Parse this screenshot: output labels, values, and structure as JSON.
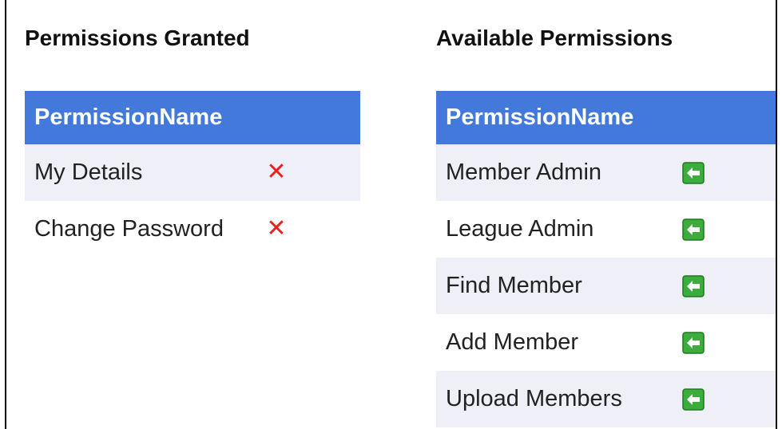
{
  "granted": {
    "title": "Permissions Granted",
    "column_header": "PermissionName",
    "rows": [
      {
        "name": "My Details",
        "action_icon": "remove-icon"
      },
      {
        "name": "Change Password",
        "action_icon": "remove-icon"
      }
    ]
  },
  "available": {
    "title": "Available Permissions",
    "column_header": "PermissionName",
    "rows": [
      {
        "name": "Member Admin",
        "action_icon": "add-arrow-icon"
      },
      {
        "name": "League Admin",
        "action_icon": "add-arrow-icon"
      },
      {
        "name": "Find Member",
        "action_icon": "add-arrow-icon"
      },
      {
        "name": "Add Member",
        "action_icon": "add-arrow-icon"
      },
      {
        "name": "Upload Members",
        "action_icon": "add-arrow-icon"
      }
    ]
  },
  "icons": {
    "remove_glyph": "✕"
  },
  "colors": {
    "header_bg": "#4379db",
    "alt_row_bg": "#eeeff7",
    "remove_red": "#e8211f",
    "add_green": "#3cac3c"
  }
}
